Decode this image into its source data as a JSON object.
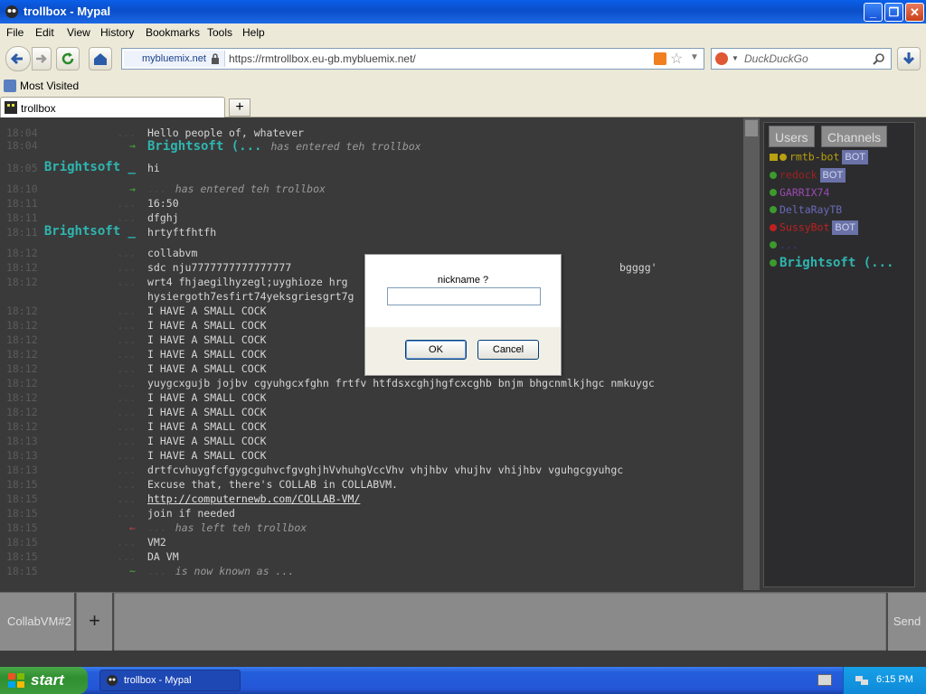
{
  "window": {
    "title": "trollbox - Mypal"
  },
  "menu": [
    "File",
    "Edit",
    "View",
    "History",
    "Bookmarks",
    "Tools",
    "Help"
  ],
  "navbar": {
    "site_identity": "mybluemix.net",
    "url": "https://rmtrollbox.eu-gb.mybluemix.net/",
    "search_placeholder": "DuckDuckGo"
  },
  "bookmarks": {
    "most_visited": "Most Visited"
  },
  "tab": {
    "label": "trollbox",
    "new_tab": "+"
  },
  "chat": {
    "messages": [
      {
        "time": "18:04",
        "nick": "...",
        "msg": "Hello people of, whatever"
      },
      {
        "time": "18:04",
        "nick": "",
        "arrow": "→",
        "inline_nick": "Brightsoft (...",
        "msg": "has entered teh trollbox"
      },
      {
        "time": "18:05",
        "nick": "Brightsoft _",
        "msg": "hi"
      },
      {
        "time": "18:10",
        "nick": "",
        "arrow": "→",
        "inline_nick": "...",
        "msg": "has entered teh trollbox"
      },
      {
        "time": "18:11",
        "nick": "...",
        "msg": "16:50"
      },
      {
        "time": "18:11",
        "nick": "...",
        "msg": "dfghj"
      },
      {
        "time": "18:11",
        "nick": "Brightsoft _",
        "msg": "hrtyftfhtfh"
      },
      {
        "time": "18:12",
        "nick": "...",
        "msg": "collabvm"
      },
      {
        "time": "18:12",
        "nick": "...",
        "msg": "sdc        nju7777777777777777"
      },
      {
        "time": "18:12",
        "nick": "...",
        "msg": "wrt4 fhjaegilhyzegl;uyghioze hrg"
      },
      {
        "time": "",
        "nick": "",
        "msg": "hysiergoth7esfirt74yeksgriesgrt7g"
      },
      {
        "time": "18:12",
        "nick": "...",
        "msg": "I HAVE A SMALL COCK"
      },
      {
        "time": "18:12",
        "nick": "...",
        "msg": "I HAVE A SMALL COCK"
      },
      {
        "time": "18:12",
        "nick": "...",
        "msg": "I HAVE A SMALL COCK"
      },
      {
        "time": "18:12",
        "nick": "...",
        "msg": "I HAVE A SMALL COCK"
      },
      {
        "time": "18:12",
        "nick": "...",
        "msg": "I HAVE A SMALL COCK"
      },
      {
        "time": "18:12",
        "nick": "...",
        "msg": "yuygcxgujb jojbv cgyuhgcxfghn frtfv htfdsxcghjhgfcxcghb bnjm bhgcnmlkjhgc nmkuygc"
      },
      {
        "time": "18:12",
        "nick": "...",
        "msg": "I HAVE A SMALL COCK"
      },
      {
        "time": "18:12",
        "nick": "...",
        "msg": "I HAVE A SMALL COCK"
      },
      {
        "time": "18:12",
        "nick": "...",
        "msg": "I HAVE A SMALL COCK"
      },
      {
        "time": "18:13",
        "nick": "...",
        "msg": "I HAVE A SMALL COCK"
      },
      {
        "time": "18:13",
        "nick": "...",
        "msg": "I HAVE A SMALL COCK"
      },
      {
        "time": "18:13",
        "nick": "...",
        "msg": "drtfcvhuygfcfgygcguhvcfgvghjhVvhuhgVccVhv vhjhbv vhujhv vhijhbv vguhgcgyuhgc"
      },
      {
        "time": "18:15",
        "nick": "...",
        "msg": "Excuse that, there's COLLAB in COLLABVM."
      },
      {
        "time": "18:15",
        "nick": "...",
        "msg": "http://computernewb.com/COLLAB-VM/",
        "link": true
      },
      {
        "time": "18:15",
        "nick": "...",
        "msg": "join if needed"
      },
      {
        "time": "18:15",
        "nick": "",
        "arrow": "←",
        "arrow_red": true,
        "inline_nick": "...",
        "msg": "has left teh trollbox"
      },
      {
        "time": "18:15",
        "nick": "...",
        "msg": "VM2"
      },
      {
        "time": "18:15",
        "nick": "...",
        "msg": "DA VM"
      },
      {
        "time": "18:15",
        "nick": "",
        "arrow": "~",
        "inline_nick": "...",
        "msg": "is now known as ..."
      }
    ],
    "right_fragment": "bgggg'"
  },
  "userpanel": {
    "tab_users": "Users",
    "tab_channels": "Channels",
    "users": [
      {
        "name": "rmtb-bot",
        "bot": "BOT",
        "color": "#b8a010",
        "status": "gold",
        "crown": true
      },
      {
        "name": "redock",
        "bot": "BOT",
        "color": "#a02020",
        "status": "green"
      },
      {
        "name": "GARRIX74",
        "bot": "",
        "color": "#9a4ab0",
        "status": "green"
      },
      {
        "name": "DeltaRayTB",
        "bot": "",
        "color": "#6a6ab8",
        "status": "green"
      },
      {
        "name": "SussyBot",
        "bot": "BOT",
        "color": "#c02020",
        "status": "red"
      },
      {
        "name": "...",
        "bot": "",
        "color": "#3a3a90",
        "status": "green"
      },
      {
        "name": "Brightsoft (...",
        "bot": "",
        "color": "#2fb5b0",
        "status": "green",
        "bold": true
      }
    ]
  },
  "inputbar": {
    "room": "CollabVM#2",
    "add": "+",
    "send": "Send"
  },
  "dialog": {
    "question": "nickname ?",
    "ok": "OK",
    "cancel": "Cancel",
    "value": ""
  },
  "taskbar": {
    "start": "start",
    "item": "trollbox - Mypal",
    "time": "6:15 PM"
  }
}
